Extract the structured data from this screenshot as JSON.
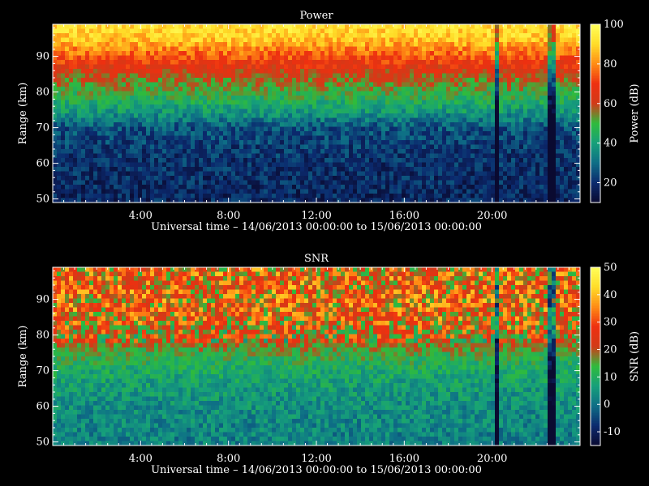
{
  "chart_data": [
    {
      "type": "heatmap",
      "title": "Power",
      "xlabel": "Universal time – 14/06/2013 00:00:00 to 15/06/2013 00:00:00",
      "ylabel": "Range (km)",
      "xlim": [
        0,
        24
      ],
      "ylim": [
        49,
        99
      ],
      "x_ticks": [
        "4:00",
        "8:00",
        "12:00",
        "16:00",
        "20:00"
      ],
      "x_tick_values": [
        4,
        8,
        12,
        16,
        20
      ],
      "y_ticks": [
        "50",
        "60",
        "70",
        "80",
        "90"
      ],
      "y_tick_values": [
        50,
        60,
        70,
        80,
        90
      ],
      "colorbar": {
        "label": "Power (dB)",
        "range": [
          10,
          100
        ],
        "ticks": [
          "20",
          "40",
          "60",
          "80",
          "100"
        ],
        "tick_values": [
          20,
          40,
          60,
          80,
          100
        ]
      },
      "colormap": [
        "#0a0a30",
        "#0b2a6e",
        "#0e6e86",
        "#16a07a",
        "#2fbb3c",
        "#d23a18",
        "#ee3010",
        "#ff8c14",
        "#ffdd28",
        "#ffff5a"
      ],
      "profile": {
        "range_km": [
          50,
          55,
          60,
          65,
          70,
          75,
          80,
          85,
          90,
          95,
          99
        ],
        "value_db": [
          18,
          19,
          20,
          22,
          26,
          40,
          50,
          60,
          74,
          88,
          92
        ]
      },
      "features": [
        {
          "hour": 20.2,
          "note": "narrow low-power streak"
        },
        {
          "hour": 22.7,
          "note": "narrow low-power streak"
        }
      ]
    },
    {
      "type": "heatmap",
      "title": "SNR",
      "xlabel": "Universal time – 14/06/2013 00:00:00 to 15/06/2013 00:00:00",
      "ylabel": "Range (km)",
      "xlim": [
        0,
        24
      ],
      "ylim": [
        49,
        99
      ],
      "x_ticks": [
        "4:00",
        "8:00",
        "12:00",
        "16:00",
        "20:00"
      ],
      "x_tick_values": [
        4,
        8,
        12,
        16,
        20
      ],
      "y_ticks": [
        "50",
        "60",
        "70",
        "80",
        "90"
      ],
      "y_tick_values": [
        50,
        60,
        70,
        80,
        90
      ],
      "colorbar": {
        "label": "SNR (dB)",
        "range": [
          -15,
          50
        ],
        "ticks": [
          "-10",
          "0",
          "10",
          "20",
          "30",
          "40",
          "50"
        ],
        "tick_values": [
          -10,
          0,
          10,
          20,
          30,
          40,
          50
        ]
      },
      "colormap": [
        "#0a0a30",
        "#0b2a6e",
        "#0e6e86",
        "#16a07a",
        "#2fbb3c",
        "#d23a18",
        "#ee3010",
        "#ff8c14",
        "#ffdd28",
        "#ffff5a"
      ],
      "profile": {
        "range_km": [
          50,
          55,
          60,
          65,
          70,
          75,
          80,
          85,
          90,
          95,
          99
        ],
        "value_db": [
          2,
          3,
          4,
          6,
          9,
          14,
          22,
          26,
          27,
          27,
          26
        ]
      },
      "features": [
        {
          "hour": 20.2,
          "note": "narrow low-SNR streak"
        },
        {
          "hour": 22.7,
          "note": "narrow low-SNR streak"
        }
      ]
    }
  ]
}
